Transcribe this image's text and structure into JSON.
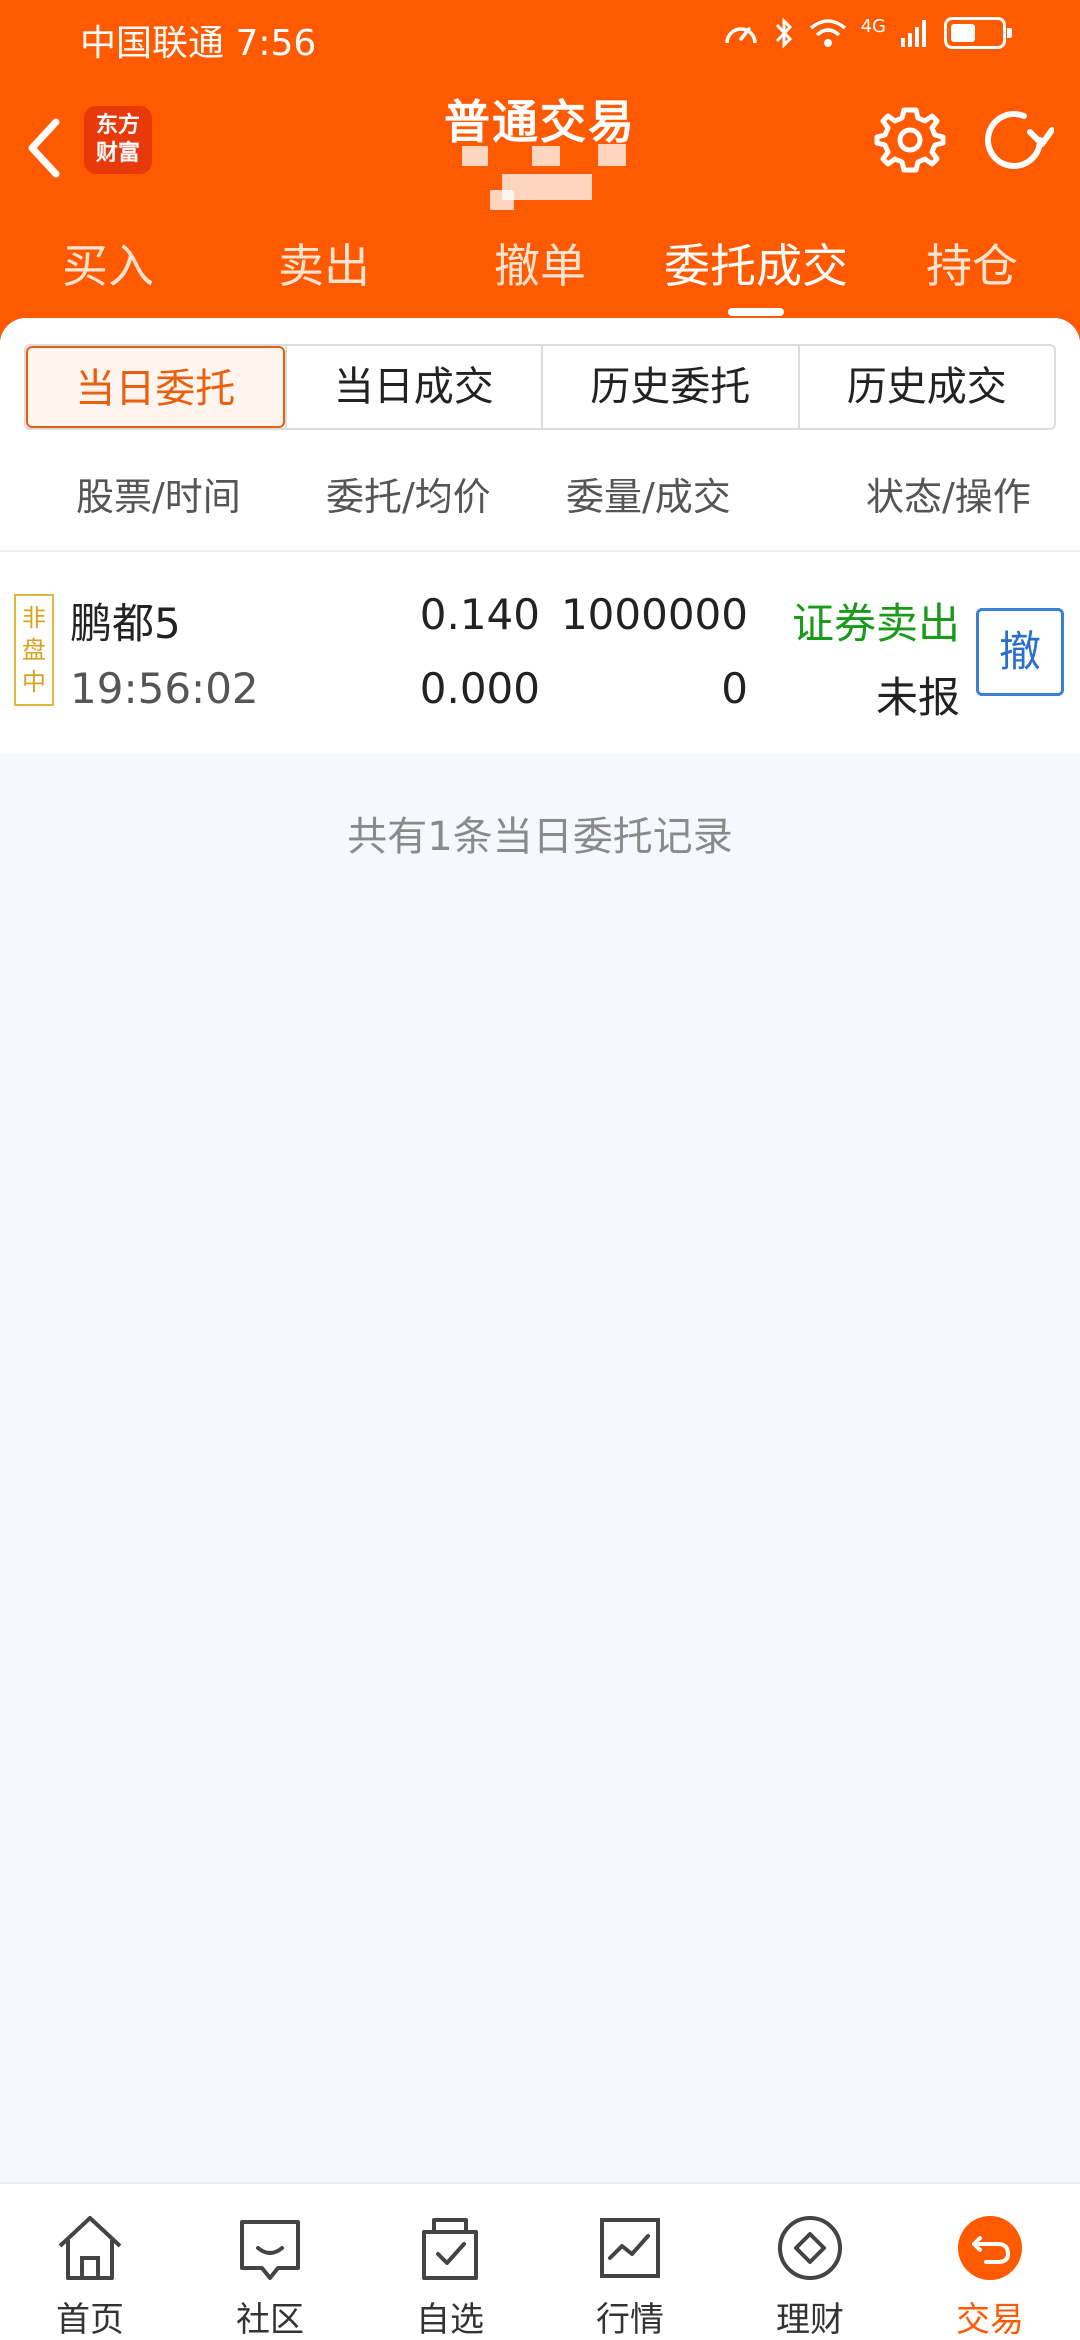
{
  "status_bar": {
    "carrier_time": "中国联通 7:56",
    "network": "4G"
  },
  "header": {
    "logo_text_line1": "东方",
    "logo_text_line2": "财富",
    "title": "普通交易",
    "accent_color": "#ff5a00"
  },
  "main_tabs": [
    {
      "label": "买入"
    },
    {
      "label": "卖出"
    },
    {
      "label": "撤单"
    },
    {
      "label": "委托成交",
      "active": true
    },
    {
      "label": "持仓"
    }
  ],
  "sub_tabs": [
    {
      "label": "当日委托",
      "active": true
    },
    {
      "label": "当日成交"
    },
    {
      "label": "历史委托"
    },
    {
      "label": "历史成交"
    }
  ],
  "columns": {
    "stock_time": "股票/时间",
    "price": "委托/均价",
    "qty": "委量/成交",
    "status": "状态/操作"
  },
  "orders": [
    {
      "badge": [
        "非",
        "盘",
        "中"
      ],
      "name": "鹏都5",
      "time": "19:56:02",
      "order_price": "0.140",
      "avg_price": "0.000",
      "order_qty": "1000000",
      "filled_qty": "0",
      "direction": "证券卖出",
      "status": "未报",
      "cancel_label": "撤",
      "direction_color": "#1a9a1a"
    }
  ],
  "summary": "共有1条当日委托记录",
  "bottom_nav": [
    {
      "label": "首页",
      "icon": "home-icon"
    },
    {
      "label": "社区",
      "icon": "community-icon"
    },
    {
      "label": "自选",
      "icon": "watchlist-icon"
    },
    {
      "label": "行情",
      "icon": "market-icon"
    },
    {
      "label": "理财",
      "icon": "wealth-icon"
    },
    {
      "label": "交易",
      "icon": "trade-icon",
      "active": true
    }
  ]
}
